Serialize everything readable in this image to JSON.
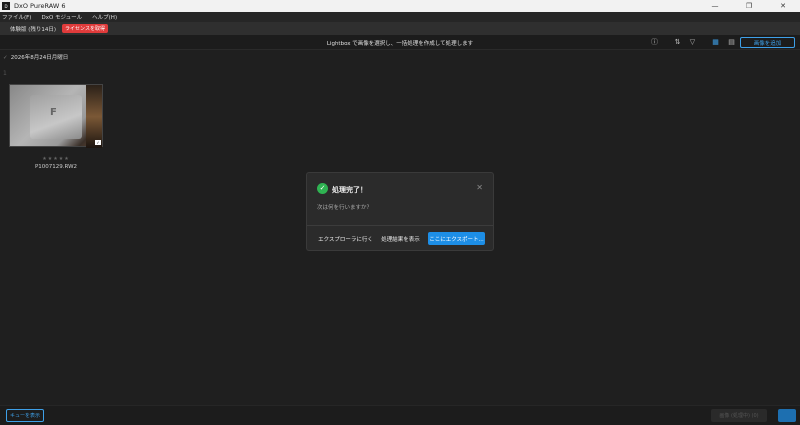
{
  "window": {
    "title": "DxO PureRAW 6",
    "controls": [
      "—",
      "❐",
      "✕"
    ]
  },
  "menu": [
    "ファイル(F)",
    "DxO モジュール",
    "ヘルプ(H)"
  ],
  "trial": {
    "text": "体験版 (残り14日)",
    "license_button": "ライセンスを取得"
  },
  "toolbar": {
    "message": "Lightbox で画像を選択し、一括処理を作成して処理します",
    "add_button": "画像を追加",
    "icons": [
      "info-icon",
      "sort-icon",
      "filter-icon",
      "grid-view-icon",
      "list-view-icon"
    ]
  },
  "gallery": {
    "date_label": "2026年8月24日月曜日",
    "count_label": "1",
    "items": [
      {
        "rating": "★★★★★",
        "filename": "P1007129.RW2"
      }
    ]
  },
  "dialog": {
    "title": "処理完了！",
    "subtitle": "次は何を行いますか？",
    "buttons": {
      "goto_explorer": "エクスプローラに行く",
      "show_results": "処理結果を表示",
      "export": "ここにエクスポート..."
    }
  },
  "bottom": {
    "queue_button": "キューを表示",
    "process_button": "画像 (処理中) (0)"
  }
}
